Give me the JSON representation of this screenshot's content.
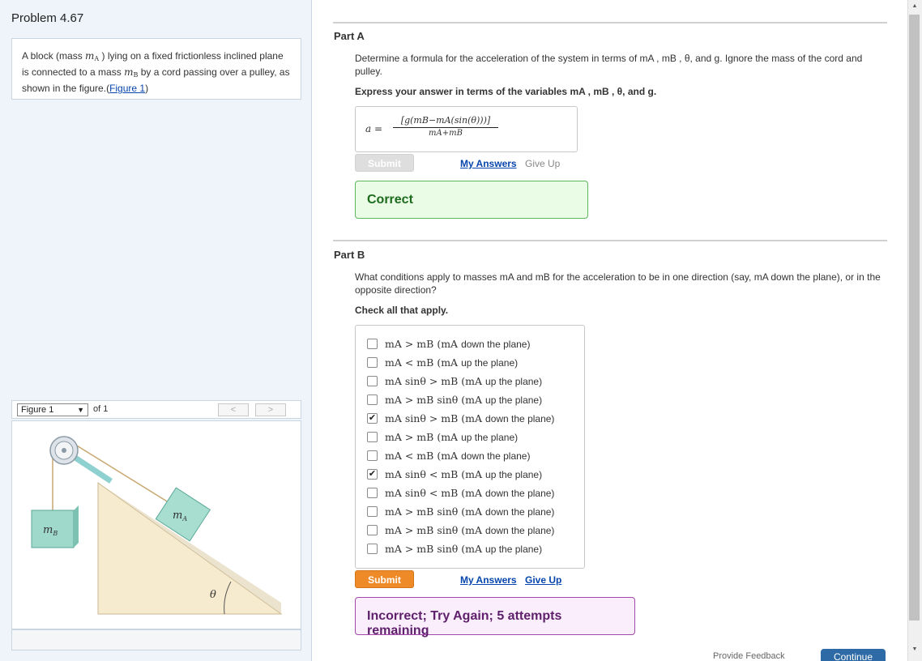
{
  "problem": {
    "title": "Problem 4.67",
    "text_parts": [
      "A block (mass ",
      " ) lying on a fixed frictionless inclined plane is connected to a mass ",
      " by a cord passing over a pulley, as shown in the figure.(",
      ")"
    ],
    "figure_link": "Figure 1",
    "mA": "m",
    "mA_sub": "A",
    "mB": "m",
    "mB_sub": "B"
  },
  "figure": {
    "select_value": "Figure 1",
    "of_label": "of 1",
    "prev_label": "<",
    "next_label": ">",
    "label_mB": "m",
    "label_mB_sub": "B",
    "label_mA": "m",
    "label_mA_sub": "A",
    "label_theta": "θ"
  },
  "partA": {
    "title": "Part A",
    "question": "Determine a formula for the acceleration of the system in terms of mA , mB , θ, and g. Ignore the mass of the cord and pulley.",
    "instruction": "Express your answer in terms of the variables mA , mB , θ, and g.",
    "answer_label": "a =",
    "answer_numerator": "[g(mB−mA(sin(θ)))]",
    "answer_denominator": "mA+mB",
    "submit_label": "Submit",
    "my_answers_label": "My Answers",
    "give_up_label": "Give Up",
    "feedback": "Correct"
  },
  "partB": {
    "title": "Part B",
    "question": "What conditions apply to masses mA and mB for the acceleration to be in one direction (say, mA down the plane), or in the opposite direction?",
    "instruction": "Check all that apply.",
    "options": [
      {
        "expr": "mA > mB (mA",
        "dir": "down the plane)",
        "checked": false
      },
      {
        "expr": "mA < mB (mA",
        "dir": "up the plane)",
        "checked": false
      },
      {
        "expr": "mA sinθ > mB (mA",
        "dir": "up the plane)",
        "checked": false
      },
      {
        "expr": "mA > mB sinθ (mA",
        "dir": "up the plane)",
        "checked": false
      },
      {
        "expr": "mA sinθ > mB (mA",
        "dir": "down the plane)",
        "checked": true
      },
      {
        "expr": "mA > mB (mA",
        "dir": "up the plane)",
        "checked": false
      },
      {
        "expr": "mA < mB (mA",
        "dir": "down the plane)",
        "checked": false
      },
      {
        "expr": "mA sinθ < mB (mA",
        "dir": "up the plane)",
        "checked": true
      },
      {
        "expr": "mA sinθ < mB (mA",
        "dir": "down the plane)",
        "checked": false
      },
      {
        "expr": "mA > mB sinθ (mA",
        "dir": "down the plane)",
        "checked": false
      },
      {
        "expr": "mA > mB sinθ (mA",
        "dir": "down the plane)",
        "checked": false
      },
      {
        "expr": "mA > mB sinθ (mA",
        "dir": "up the plane)",
        "checked": false
      }
    ],
    "submit_label": "Submit",
    "my_answers_label": "My Answers",
    "give_up_label": "Give Up",
    "feedback": "Incorrect; Try Again; 5 attempts remaining"
  },
  "footer": {
    "feedback_link": "Provide Feedback",
    "continue_label": "Continue"
  },
  "colors": {
    "accent_orange": "#ee8a27",
    "correct_green": "#5cb85c",
    "incorrect_purple": "#a148a8",
    "link_blue": "#0645ad"
  }
}
